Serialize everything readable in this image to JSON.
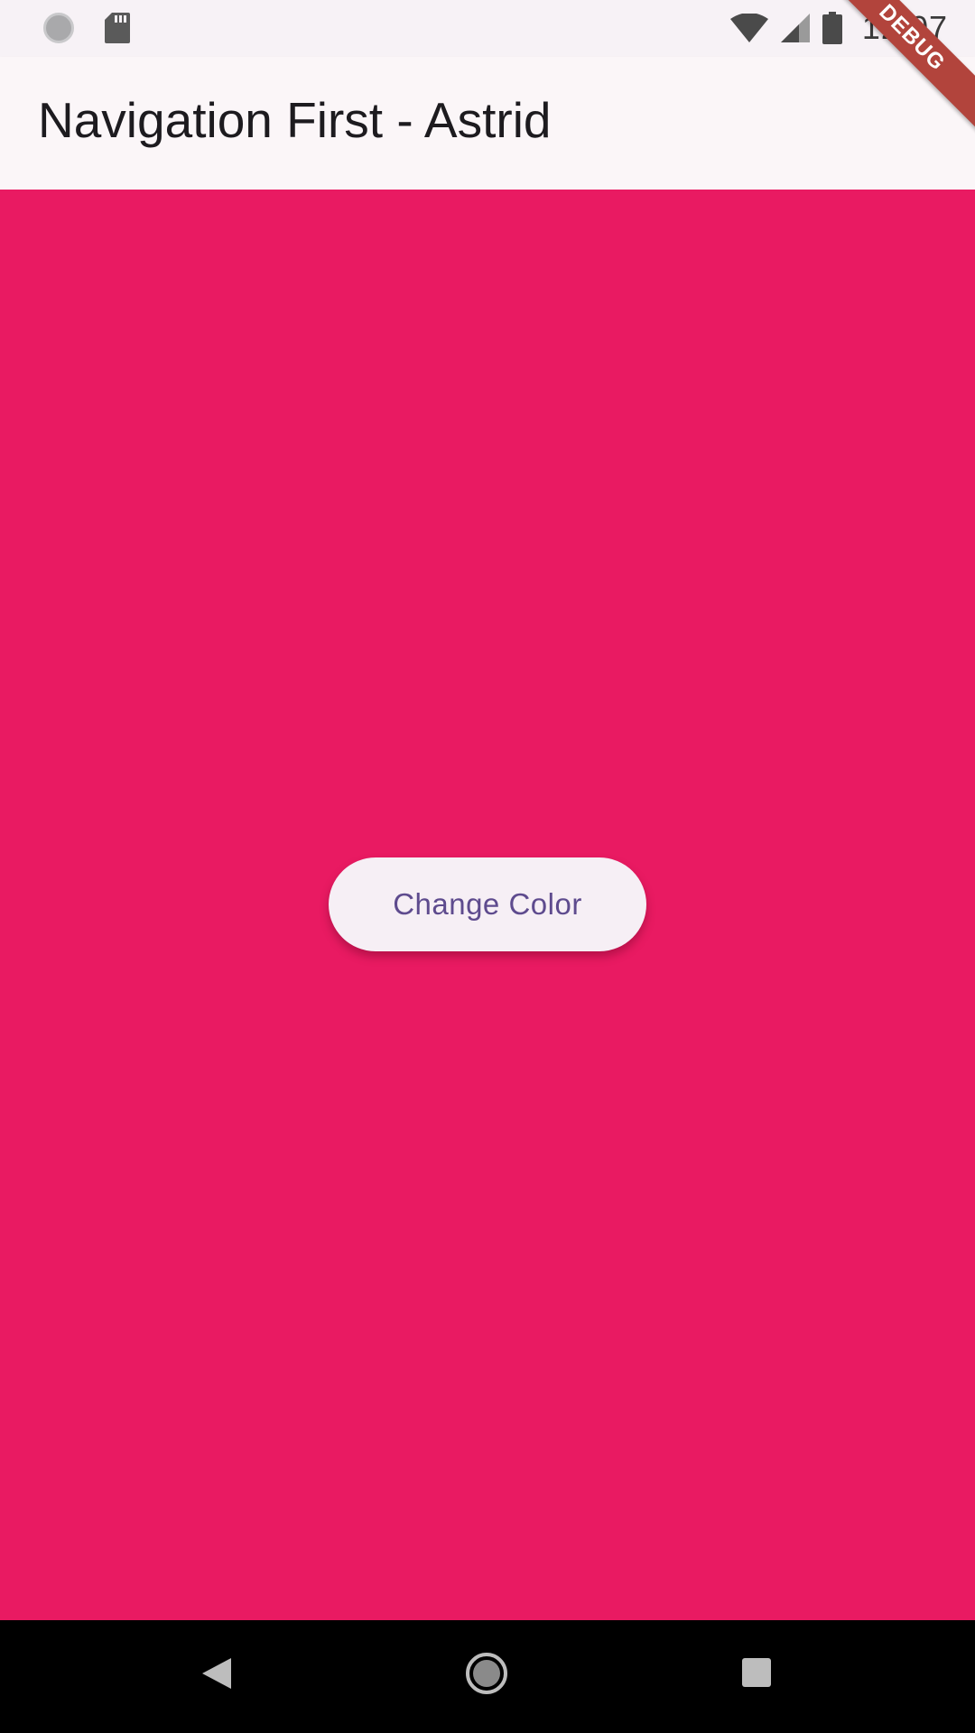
{
  "status_bar": {
    "time": "12:07",
    "icons": [
      "circle-icon",
      "sd-card-icon",
      "wifi-icon",
      "signal-icon",
      "battery-icon"
    ]
  },
  "app_bar": {
    "title": "Navigation First - Astrid"
  },
  "debug_banner": {
    "label": "DEBUG"
  },
  "main": {
    "button_label": "Change Color",
    "background_color": "#e91a62"
  },
  "nav_bar": {
    "icons": [
      "back-icon",
      "home-icon",
      "recents-icon"
    ]
  },
  "colors": {
    "accent": "#e91a62",
    "button_text": "#5e4b8e",
    "app_bar_bg": "#fbf6f8",
    "debug_banner": "#b2443c"
  }
}
